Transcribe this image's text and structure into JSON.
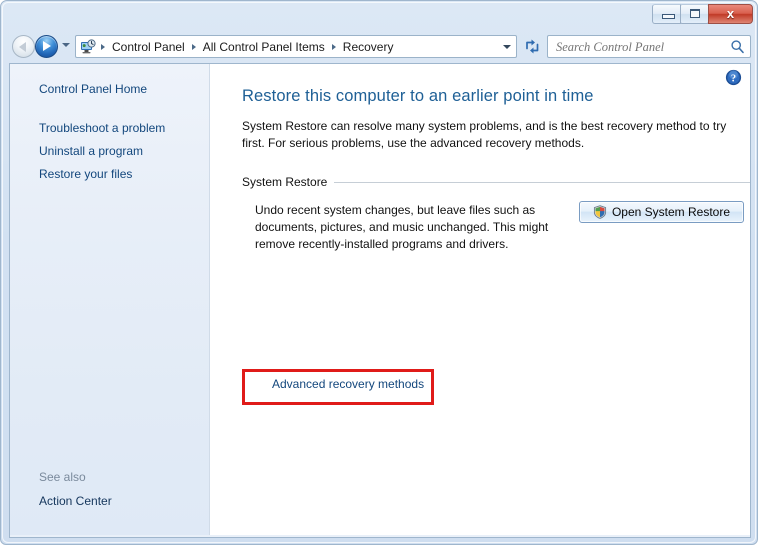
{
  "window": {
    "controls": {
      "minimize_label": "Minimize",
      "maximize_label": "Maximize",
      "close_label": "x"
    }
  },
  "nav_bar": {
    "back_label": "Back",
    "forward_label": "Forward",
    "history_label": "Recent pages",
    "breadcrumb_icon": "control-panel-icon",
    "breadcrumbs": [
      {
        "label": "Control Panel"
      },
      {
        "label": "All Control Panel Items"
      },
      {
        "label": "Recovery"
      }
    ],
    "address_dropdown_label": "Previous locations",
    "refresh_label": "Refresh",
    "search": {
      "placeholder": "Search Control Panel",
      "value": "",
      "icon": "search-icon"
    }
  },
  "nav_pane": {
    "home_link": "Control Panel Home",
    "items": [
      {
        "label": "Troubleshoot a problem"
      },
      {
        "label": "Uninstall a program"
      },
      {
        "label": "Restore your files"
      }
    ],
    "see_also": {
      "label": "See also",
      "links": [
        {
          "label": "Action Center"
        }
      ]
    }
  },
  "detail_pane": {
    "help_label": "Help",
    "title": "Restore this computer to an earlier point in time",
    "intro": "System Restore can resolve many system problems, and is the best recovery method to try first. For serious problems, use the advanced recovery methods.",
    "group": {
      "label": "System Restore",
      "body": "Undo recent system changes, but leave files such as documents, pictures, and music unchanged. This might remove recently-installed programs and drivers.",
      "button_label": "Open System Restore",
      "button_icon": "uac-shield-icon"
    },
    "advanced_link": "Advanced recovery methods"
  },
  "colors": {
    "frame": "#d2e1f2",
    "title_accent": "#1f6096",
    "link": "#13477d",
    "annotation": "#e01b19",
    "close_button": "#c03a27",
    "nav_pane_bg": "#e7eef8"
  }
}
